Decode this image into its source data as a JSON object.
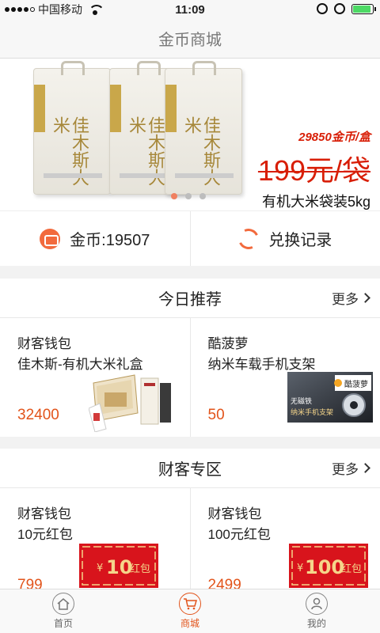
{
  "status": {
    "carrier": "中国移动",
    "time": "11:09",
    "battery_level": 0.9
  },
  "header": {
    "title": "金币商城"
  },
  "banner": {
    "bag_brand": "佳木斯大米",
    "coins_text": "29850金币/盒",
    "price_text": "199元/袋",
    "product_name": "有机大米袋装5kg",
    "slide_count": 3,
    "active_slide": 1
  },
  "wallet": {
    "coins_label": "金币:19507",
    "history_label": "兑换记录"
  },
  "recommend": {
    "title": "今日推荐",
    "more_label": "更多",
    "items": [
      {
        "shop": "财客钱包",
        "name": "佳木斯-有机大米礼盒",
        "price": "32400"
      },
      {
        "shop": "酷菠萝",
        "name": "纳米车载手机支架",
        "price": "50",
        "thumb_brand": "酷菠萝",
        "thumb_caption_1": "无磁铁",
        "thumb_caption_2": "纳米手机支架"
      }
    ]
  },
  "zone": {
    "title": "财客专区",
    "more_label": "更多",
    "items": [
      {
        "shop": "财客钱包",
        "name": "10元红包",
        "price": "799",
        "coupon_amount": "10",
        "coupon_unit": "红包",
        "coupon_symbol": "¥"
      },
      {
        "shop": "财客钱包",
        "name": "100元红包",
        "price": "2499",
        "coupon_amount": "100",
        "coupon_unit": "红包",
        "coupon_symbol": "¥"
      }
    ]
  },
  "tabs": [
    {
      "label": "首页",
      "icon": "home-icon"
    },
    {
      "label": "商城",
      "icon": "cart-icon",
      "active": true
    },
    {
      "label": "我的",
      "icon": "user-icon"
    }
  ],
  "colors": {
    "accent": "#e2541b",
    "price_red": "#d81e06",
    "coupon_red": "#d8141c",
    "coupon_gold": "#f5d58a"
  }
}
